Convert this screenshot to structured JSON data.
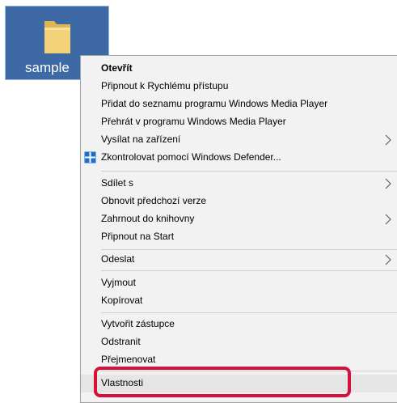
{
  "desktop_icon": {
    "label": "sample",
    "selection_color": "#3d6aa4"
  },
  "context_menu": {
    "items": [
      {
        "label": "Otevřít",
        "bold": true
      },
      {
        "label": "Připnout k Rychlému přístupu"
      },
      {
        "label": "Přidat do seznamu programu Windows Media Player"
      },
      {
        "label": "Přehrát v programu Windows Media Player"
      },
      {
        "label": "Vysílat na zařízení",
        "submenu": true
      },
      {
        "label": "Zkontrolovat pomocí Windows Defender...",
        "icon": "windows-defender-icon"
      },
      {
        "label": "Sdílet s",
        "submenu": true
      },
      {
        "label": "Obnovit předchozí verze"
      },
      {
        "label": "Zahrnout do knihovny",
        "submenu": true
      },
      {
        "label": "Připnout na Start"
      },
      {
        "label": "Odeslat",
        "submenu": true
      },
      {
        "label": "Vyjmout"
      },
      {
        "label": "Kopírovat"
      },
      {
        "label": "Vytvořit zástupce"
      },
      {
        "label": "Odstranit"
      },
      {
        "label": "Přejmenovat"
      },
      {
        "label": "Vlastnosti",
        "highlighted": true
      }
    ]
  },
  "highlight_color": "#d7113b"
}
